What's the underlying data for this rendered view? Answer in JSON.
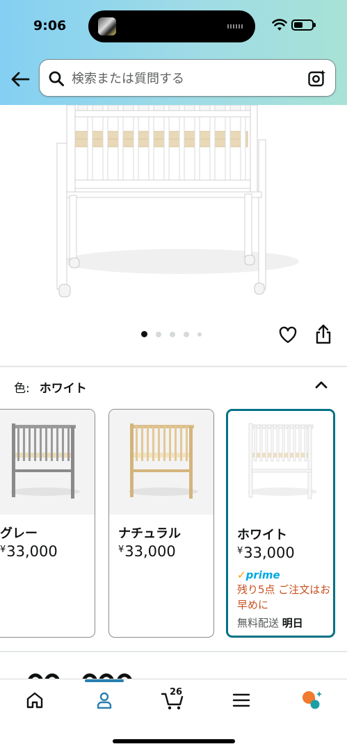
{
  "status_bar": {
    "time": "9:06",
    "icons": [
      "wifi-icon",
      "battery-icon"
    ]
  },
  "header": {
    "back_icon": "arrow-left-icon",
    "search": {
      "placeholder": "検索または質問する",
      "icon": "search-icon",
      "camera_icon": "camera-search-icon"
    }
  },
  "gallery": {
    "image": "white-baby-crib",
    "dots_total": 5,
    "active_dot": 1,
    "actions": [
      "heart-icon",
      "share-icon"
    ]
  },
  "color_selector": {
    "label": "色:",
    "selected_value": "ホワイト",
    "collapse_icon": "chevron-up-icon",
    "options": [
      {
        "name": "グレー",
        "currency": "¥",
        "price": "33,000",
        "color": "#8d8d8d",
        "selected": false
      },
      {
        "name": "ナチュラル",
        "currency": "¥",
        "price": "33,000",
        "color": "#e6cd9c",
        "selected": false
      },
      {
        "name": "ホワイト",
        "currency": "¥",
        "price": "33,000",
        "color": "#f4f4f4",
        "selected": true,
        "prime": "prime",
        "stock_notice": "残り5点 ご注文はお早めに",
        "delivery_label": "無料配送",
        "delivery_day": "明日"
      }
    ]
  },
  "bottom_nav": {
    "items": [
      "home-icon",
      "account-icon",
      "cart-icon",
      "menu-icon",
      "assistant-icon"
    ],
    "cart_count": "26",
    "active_item": "account-icon"
  },
  "colors": {
    "accent_teal": "#007185",
    "stock_red": "#c7511f",
    "prime_blue": "#00a8e1"
  }
}
